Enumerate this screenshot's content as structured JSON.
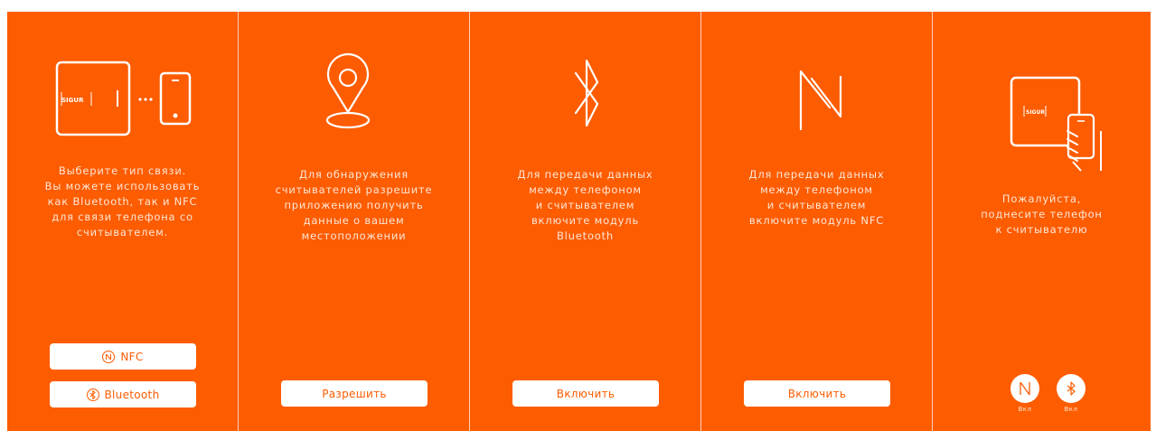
{
  "colors": {
    "brand_orange": "#fd5c00",
    "white": "#ffffff",
    "text_light": "#ffe6d6"
  },
  "panel1": {
    "logo_text": "SIGUR",
    "text": "Выберите тип связи.\nВы можете использовать\nкак Bluetooth, так и NFC\nдля связи телефона со\nсчитывателем.",
    "nfc_button": {
      "icon": "nfc-icon",
      "label": "NFC"
    },
    "bluetooth_button": {
      "icon": "bluetooth-icon",
      "label": "Bluetooth"
    }
  },
  "panel2": {
    "icon": "location-pin-icon",
    "text": "Для обнаружения\nсчитывателей разрешите\nприложению получить\nданные о вашем\nместоположении",
    "button_label": "Разрешить"
  },
  "panel3": {
    "icon": "bluetooth-icon",
    "text": "Для передачи данных\nмежду телефоном\nи считывателем\nвключите модуль\nBluetooth",
    "button_label": "Включить"
  },
  "panel4": {
    "icon": "nfc-n-icon",
    "text": "Для передачи данных\nмежду телефоном\nи считывателем\nвключите модуль NFC",
    "button_label": "Включить"
  },
  "panel5": {
    "logo_text": "SIGUR",
    "text": "Пожалуйста,\nподнесите телефон\nк считывателю",
    "nfc_status": {
      "icon": "nfc-icon",
      "label": "Вкл"
    },
    "bluetooth_status": {
      "icon": "bluetooth-icon",
      "label": "Вкл"
    }
  }
}
